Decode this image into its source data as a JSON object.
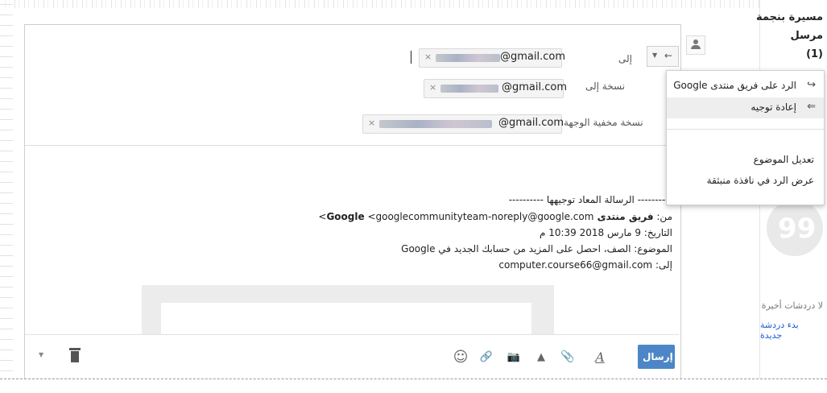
{
  "sidebar": {
    "title": "مسيرة بنجمة",
    "subtitle": "مرسل",
    "count": "(1)",
    "no_recent_chats": "لا دردشات أخيرة",
    "start_new_chat": "بدء دردشة جديدة"
  },
  "compose": {
    "to_label": "إلى",
    "cc_label": "نسخة إلى",
    "bcc_label": "نسخة مخفية الوجهة",
    "to_recipient": "@gmail.com",
    "cc_recipient": "@gmail.com",
    "bcc_recipient": "@gmail.com",
    "chip_remove": "×",
    "reply_type_arrow": "←",
    "reply_type_caret": "▼",
    "forwarded_header": "---------- الرسالة المعاد توجيهها ----------",
    "from_label": "من:",
    "from_name": "فريق منتدى Google",
    "from_email": "<googlecommunityteam-noreply@google.com>",
    "date_line": "التاريخ: 9 مارس 2018 10:39 م",
    "subject_line": "الموضوع: الصف، احصل على المزيد من حسابك الجديد في Google",
    "to_line_label": "إلى:",
    "to_line_email": "computer.course66@gmail.com"
  },
  "toolbar": {
    "send_label": "إرسال",
    "format_icon": "A",
    "attach_icon": "📎",
    "drive_icon": "▲",
    "photo_icon": "📷",
    "link_icon": "🔗",
    "emoji_icon": "☺",
    "more_caret": "▼"
  },
  "menu": {
    "items": [
      {
        "label": "الرد على فريق منتدى Google",
        "icon": "reply-icon",
        "glyph": "↪"
      },
      {
        "label": "إعادة توجيه",
        "icon": "forward-icon",
        "glyph": "⇐"
      },
      {
        "label": "تعديل الموضوع",
        "icon": "",
        "glyph": ""
      },
      {
        "label": "عرض الرد في نافذة منبثقة",
        "icon": "",
        "glyph": ""
      }
    ]
  },
  "colors": {
    "send_button": "#4d86c7",
    "link_blue": "#1a5ad7",
    "menu_highlight": "#eeeeee"
  }
}
